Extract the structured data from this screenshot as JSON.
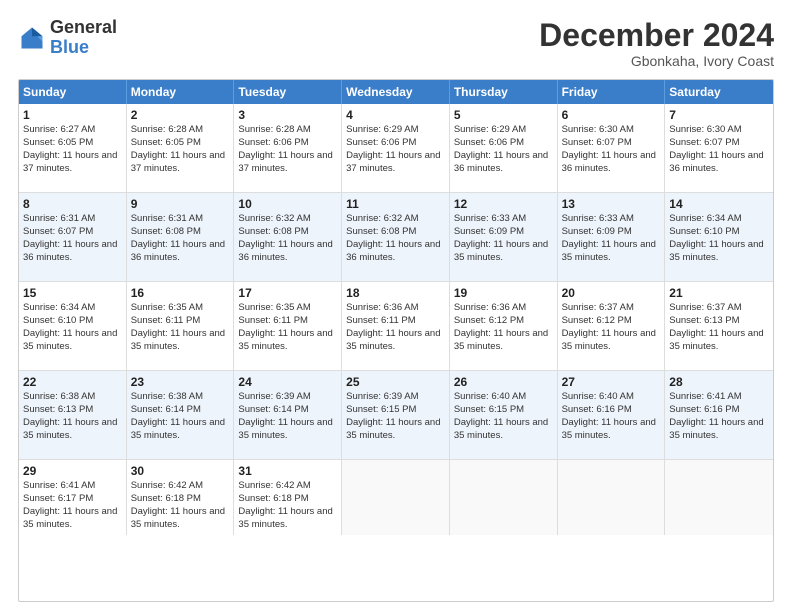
{
  "logo": {
    "general": "General",
    "blue": "Blue"
  },
  "title": "December 2024",
  "location": "Gbonkaha, Ivory Coast",
  "days": [
    "Sunday",
    "Monday",
    "Tuesday",
    "Wednesday",
    "Thursday",
    "Friday",
    "Saturday"
  ],
  "weeks": [
    [
      {
        "day": "1",
        "sunrise": "6:27 AM",
        "sunset": "6:05 PM",
        "daylight": "11 hours and 37 minutes."
      },
      {
        "day": "2",
        "sunrise": "6:28 AM",
        "sunset": "6:05 PM",
        "daylight": "11 hours and 37 minutes."
      },
      {
        "day": "3",
        "sunrise": "6:28 AM",
        "sunset": "6:06 PM",
        "daylight": "11 hours and 37 minutes."
      },
      {
        "day": "4",
        "sunrise": "6:29 AM",
        "sunset": "6:06 PM",
        "daylight": "11 hours and 37 minutes."
      },
      {
        "day": "5",
        "sunrise": "6:29 AM",
        "sunset": "6:06 PM",
        "daylight": "11 hours and 36 minutes."
      },
      {
        "day": "6",
        "sunrise": "6:30 AM",
        "sunset": "6:07 PM",
        "daylight": "11 hours and 36 minutes."
      },
      {
        "day": "7",
        "sunrise": "6:30 AM",
        "sunset": "6:07 PM",
        "daylight": "11 hours and 36 minutes."
      }
    ],
    [
      {
        "day": "8",
        "sunrise": "6:31 AM",
        "sunset": "6:07 PM",
        "daylight": "11 hours and 36 minutes."
      },
      {
        "day": "9",
        "sunrise": "6:31 AM",
        "sunset": "6:08 PM",
        "daylight": "11 hours and 36 minutes."
      },
      {
        "day": "10",
        "sunrise": "6:32 AM",
        "sunset": "6:08 PM",
        "daylight": "11 hours and 36 minutes."
      },
      {
        "day": "11",
        "sunrise": "6:32 AM",
        "sunset": "6:08 PM",
        "daylight": "11 hours and 36 minutes."
      },
      {
        "day": "12",
        "sunrise": "6:33 AM",
        "sunset": "6:09 PM",
        "daylight": "11 hours and 35 minutes."
      },
      {
        "day": "13",
        "sunrise": "6:33 AM",
        "sunset": "6:09 PM",
        "daylight": "11 hours and 35 minutes."
      },
      {
        "day": "14",
        "sunrise": "6:34 AM",
        "sunset": "6:10 PM",
        "daylight": "11 hours and 35 minutes."
      }
    ],
    [
      {
        "day": "15",
        "sunrise": "6:34 AM",
        "sunset": "6:10 PM",
        "daylight": "11 hours and 35 minutes."
      },
      {
        "day": "16",
        "sunrise": "6:35 AM",
        "sunset": "6:11 PM",
        "daylight": "11 hours and 35 minutes."
      },
      {
        "day": "17",
        "sunrise": "6:35 AM",
        "sunset": "6:11 PM",
        "daylight": "11 hours and 35 minutes."
      },
      {
        "day": "18",
        "sunrise": "6:36 AM",
        "sunset": "6:11 PM",
        "daylight": "11 hours and 35 minutes."
      },
      {
        "day": "19",
        "sunrise": "6:36 AM",
        "sunset": "6:12 PM",
        "daylight": "11 hours and 35 minutes."
      },
      {
        "day": "20",
        "sunrise": "6:37 AM",
        "sunset": "6:12 PM",
        "daylight": "11 hours and 35 minutes."
      },
      {
        "day": "21",
        "sunrise": "6:37 AM",
        "sunset": "6:13 PM",
        "daylight": "11 hours and 35 minutes."
      }
    ],
    [
      {
        "day": "22",
        "sunrise": "6:38 AM",
        "sunset": "6:13 PM",
        "daylight": "11 hours and 35 minutes."
      },
      {
        "day": "23",
        "sunrise": "6:38 AM",
        "sunset": "6:14 PM",
        "daylight": "11 hours and 35 minutes."
      },
      {
        "day": "24",
        "sunrise": "6:39 AM",
        "sunset": "6:14 PM",
        "daylight": "11 hours and 35 minutes."
      },
      {
        "day": "25",
        "sunrise": "6:39 AM",
        "sunset": "6:15 PM",
        "daylight": "11 hours and 35 minutes."
      },
      {
        "day": "26",
        "sunrise": "6:40 AM",
        "sunset": "6:15 PM",
        "daylight": "11 hours and 35 minutes."
      },
      {
        "day": "27",
        "sunrise": "6:40 AM",
        "sunset": "6:16 PM",
        "daylight": "11 hours and 35 minutes."
      },
      {
        "day": "28",
        "sunrise": "6:41 AM",
        "sunset": "6:16 PM",
        "daylight": "11 hours and 35 minutes."
      }
    ],
    [
      {
        "day": "29",
        "sunrise": "6:41 AM",
        "sunset": "6:17 PM",
        "daylight": "11 hours and 35 minutes."
      },
      {
        "day": "30",
        "sunrise": "6:42 AM",
        "sunset": "6:18 PM",
        "daylight": "11 hours and 35 minutes."
      },
      {
        "day": "31",
        "sunrise": "6:42 AM",
        "sunset": "6:18 PM",
        "daylight": "11 hours and 35 minutes."
      },
      null,
      null,
      null,
      null
    ]
  ]
}
